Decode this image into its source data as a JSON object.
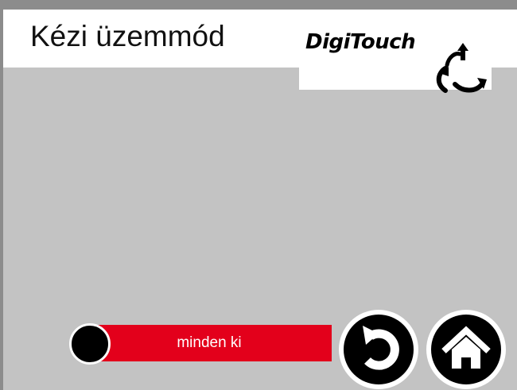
{
  "header": {
    "title": "Kézi üzemmód",
    "logo_text": "DigiTouch"
  },
  "controls": {
    "all_off_label": "minden ki",
    "all_off_color": "#e3001b"
  },
  "nav": {
    "back_icon": "back-arrow-icon",
    "home_icon": "home-icon"
  },
  "colors": {
    "background": "#c3c3c3",
    "frame": "#8c8c8c"
  }
}
